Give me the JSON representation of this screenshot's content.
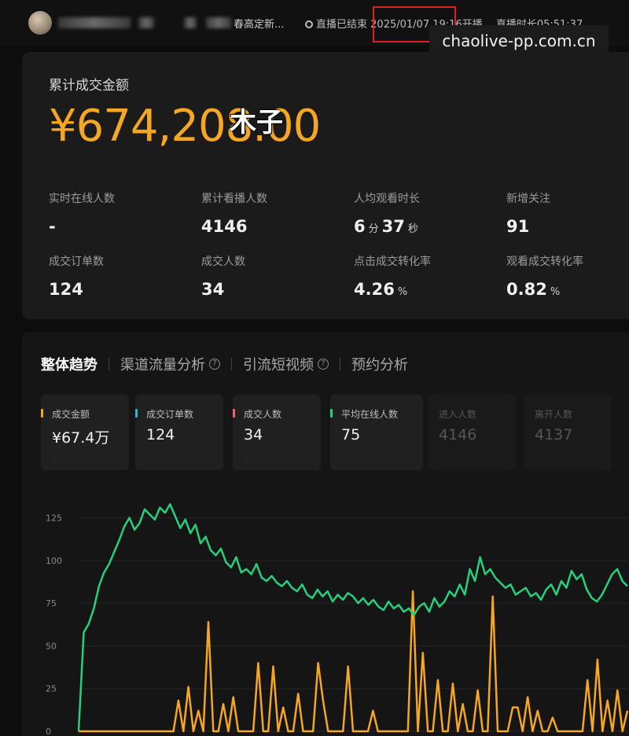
{
  "header": {
    "title_tail": "春高定新...",
    "status": "直播已结束",
    "start_info": "2025/01/07 19:16开播",
    "duration": "直播时长05:51:37",
    "watermark": "chaolive-pp.com.cn"
  },
  "summary": {
    "gmv_label": "累计成交金额",
    "gmv_value": "¥674,208.00",
    "sticker": "木子",
    "stats": [
      {
        "label": "实时在线人数",
        "value": "-"
      },
      {
        "label": "累计看播人数",
        "value": "4146"
      },
      {
        "label": "人均观看时长",
        "value_min": "6",
        "unit_min": "分",
        "value_sec": "37",
        "unit_sec": "秒"
      },
      {
        "label": "新增关注",
        "value": "91"
      },
      {
        "label": "成交订单数",
        "value": "124"
      },
      {
        "label": "成交人数",
        "value": "34"
      },
      {
        "label": "点击成交转化率",
        "value": "4.26",
        "unit": "%"
      },
      {
        "label": "观看成交转化率",
        "value": "0.82",
        "unit": "%"
      }
    ]
  },
  "tabs": [
    {
      "label": "整体趋势",
      "active": true,
      "help": false
    },
    {
      "label": "渠道流量分析",
      "active": false,
      "help": true
    },
    {
      "label": "引流短视频",
      "active": false,
      "help": true
    },
    {
      "label": "预约分析",
      "active": false,
      "help": false
    }
  ],
  "metrics": [
    {
      "label": "成交金额",
      "value": "¥67.4万",
      "color": "#f5a623",
      "dim": false
    },
    {
      "label": "成交订单数",
      "value": "124",
      "color": "#29b6d6",
      "dim": false
    },
    {
      "label": "成交人数",
      "value": "34",
      "color": "#f0626e",
      "dim": false
    },
    {
      "label": "平均在线人数",
      "value": "75",
      "color": "#26d07c",
      "dim": false
    },
    {
      "label": "进入人数",
      "value": "4146",
      "color": "",
      "dim": true
    },
    {
      "label": "离开人数",
      "value": "4137",
      "color": "",
      "dim": true
    }
  ],
  "chart_data": {
    "type": "line",
    "yticks": [
      "0",
      "25",
      "50",
      "75",
      "100",
      "125"
    ],
    "ylim": [
      0,
      140
    ],
    "series": [
      {
        "color": "#26d07c",
        "values": [
          0,
          58,
          63,
          72,
          85,
          93,
          98,
          105,
          112,
          120,
          125,
          118,
          122,
          130,
          127,
          124,
          131,
          128,
          133,
          126,
          119,
          124,
          116,
          121,
          110,
          114,
          106,
          103,
          107,
          99,
          96,
          102,
          93,
          95,
          92,
          98,
          90,
          88,
          91,
          87,
          85,
          88,
          84,
          82,
          86,
          80,
          78,
          83,
          79,
          82,
          76,
          80,
          77,
          81,
          79,
          75,
          78,
          74,
          77,
          73,
          71,
          76,
          72,
          74,
          70,
          72,
          68,
          73,
          75,
          70,
          78,
          73,
          76,
          82,
          79,
          86,
          80,
          95,
          88,
          102,
          92,
          95,
          90,
          87,
          84,
          86,
          80,
          82,
          84,
          79,
          81,
          77,
          83,
          86,
          80,
          88,
          84,
          94,
          89,
          92,
          83,
          78,
          76,
          80,
          86,
          92,
          95,
          88,
          85
        ]
      },
      {
        "color": "#f5a623",
        "values": [
          0,
          0,
          0,
          0,
          0,
          0,
          0,
          0,
          0,
          0,
          0,
          0,
          0,
          0,
          0,
          0,
          0,
          0,
          0,
          0,
          18,
          0,
          26,
          0,
          12,
          0,
          64,
          0,
          0,
          16,
          0,
          20,
          0,
          0,
          0,
          0,
          40,
          0,
          0,
          38,
          0,
          14,
          0,
          0,
          22,
          0,
          0,
          0,
          40,
          18,
          0,
          0,
          0,
          0,
          38,
          0,
          0,
          0,
          0,
          12,
          0,
          0,
          0,
          0,
          0,
          0,
          0,
          82,
          0,
          46,
          0,
          0,
          30,
          0,
          0,
          28,
          0,
          16,
          0,
          0,
          24,
          0,
          0,
          79,
          0,
          0,
          0,
          14,
          14,
          0,
          20,
          0,
          12,
          0,
          0,
          8,
          0,
          0,
          0,
          0,
          0,
          0,
          30,
          0,
          42,
          0,
          18,
          0,
          24,
          0,
          12
        ]
      }
    ]
  }
}
